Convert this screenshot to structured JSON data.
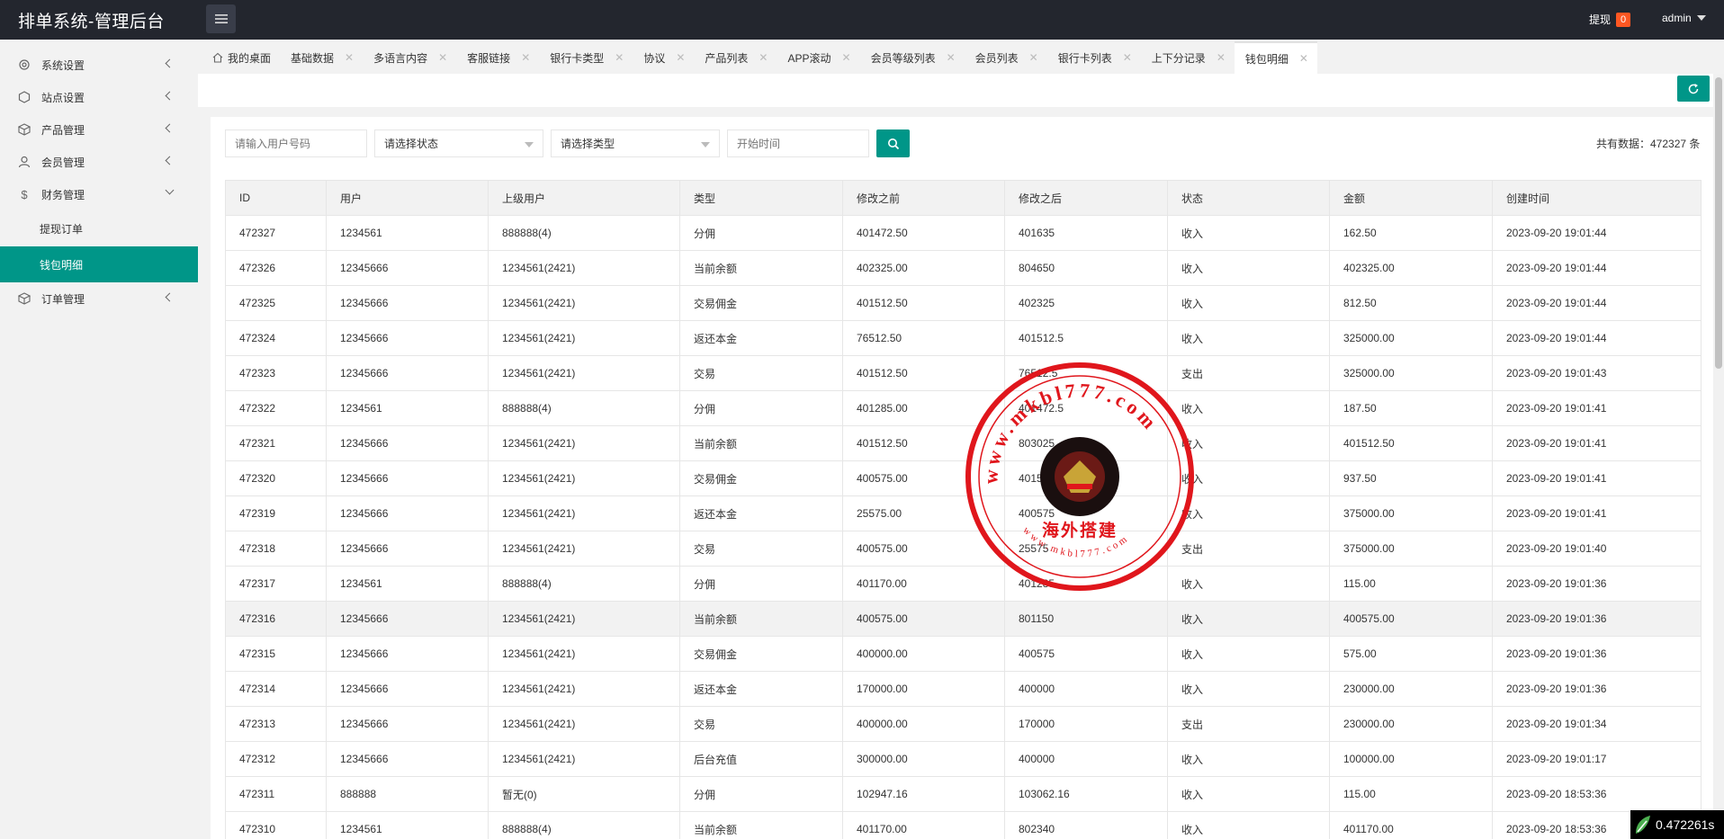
{
  "app": {
    "title": "排单系统-管理后台"
  },
  "header": {
    "withdraw_label": "提现",
    "withdraw_badge": "0",
    "user": "admin"
  },
  "sidebar": {
    "items": [
      {
        "label": "系统设置",
        "icon": "gear-icon"
      },
      {
        "label": "站点设置",
        "icon": "settings-icon"
      },
      {
        "label": "产品管理",
        "icon": "cube-icon"
      },
      {
        "label": "会员管理",
        "icon": "user-icon"
      },
      {
        "label": "财务管理",
        "icon": "dollar-icon"
      },
      {
        "label": "订单管理",
        "icon": "cube-icon"
      }
    ],
    "sub_items": [
      {
        "label": "提现订单"
      },
      {
        "label": "钱包明细"
      }
    ]
  },
  "tabs": [
    {
      "label": "我的桌面"
    },
    {
      "label": "基础数据"
    },
    {
      "label": "多语言内容"
    },
    {
      "label": "客服链接"
    },
    {
      "label": "银行卡类型"
    },
    {
      "label": "协议"
    },
    {
      "label": "产品列表"
    },
    {
      "label": "APP滚动"
    },
    {
      "label": "会员等级列表"
    },
    {
      "label": "会员列表"
    },
    {
      "label": "银行卡列表"
    },
    {
      "label": "上下分记录"
    },
    {
      "label": "钱包明细"
    }
  ],
  "filters": {
    "user_placeholder": "请输入用户号码",
    "status_select": "请选择状态",
    "type_select": "请选择类型",
    "time_placeholder": "开始时间"
  },
  "summary": {
    "total_text": "共有数据：472327 条"
  },
  "table": {
    "headers": [
      "ID",
      "用户",
      "上级用户",
      "类型",
      "修改之前",
      "修改之后",
      "状态",
      "金额",
      "创建时间"
    ],
    "rows": [
      [
        "472327",
        "1234561",
        "888888(4)",
        "分佣",
        "401472.50",
        "401635",
        "收入",
        "162.50",
        "2023-09-20 19:01:44"
      ],
      [
        "472326",
        "12345666",
        "1234561(2421)",
        "当前余额",
        "402325.00",
        "804650",
        "收入",
        "402325.00",
        "2023-09-20 19:01:44"
      ],
      [
        "472325",
        "12345666",
        "1234561(2421)",
        "交易佣金",
        "401512.50",
        "402325",
        "收入",
        "812.50",
        "2023-09-20 19:01:44"
      ],
      [
        "472324",
        "12345666",
        "1234561(2421)",
        "返还本金",
        "76512.50",
        "401512.5",
        "收入",
        "325000.00",
        "2023-09-20 19:01:44"
      ],
      [
        "472323",
        "12345666",
        "1234561(2421)",
        "交易",
        "401512.50",
        "76512.5",
        "支出",
        "325000.00",
        "2023-09-20 19:01:43"
      ],
      [
        "472322",
        "1234561",
        "888888(4)",
        "分佣",
        "401285.00",
        "401472.5",
        "收入",
        "187.50",
        "2023-09-20 19:01:41"
      ],
      [
        "472321",
        "12345666",
        "1234561(2421)",
        "当前余额",
        "401512.50",
        "803025",
        "收入",
        "401512.50",
        "2023-09-20 19:01:41"
      ],
      [
        "472320",
        "12345666",
        "1234561(2421)",
        "交易佣金",
        "400575.00",
        "401512.5",
        "收入",
        "937.50",
        "2023-09-20 19:01:41"
      ],
      [
        "472319",
        "12345666",
        "1234561(2421)",
        "返还本金",
        "25575.00",
        "400575",
        "收入",
        "375000.00",
        "2023-09-20 19:01:41"
      ],
      [
        "472318",
        "12345666",
        "1234561(2421)",
        "交易",
        "400575.00",
        "25575",
        "支出",
        "375000.00",
        "2023-09-20 19:01:40"
      ],
      [
        "472317",
        "1234561",
        "888888(4)",
        "分佣",
        "401170.00",
        "401285",
        "收入",
        "115.00",
        "2023-09-20 19:01:36"
      ],
      [
        "472316",
        "12345666",
        "1234561(2421)",
        "当前余额",
        "400575.00",
        "801150",
        "收入",
        "400575.00",
        "2023-09-20 19:01:36"
      ],
      [
        "472315",
        "12345666",
        "1234561(2421)",
        "交易佣金",
        "400000.00",
        "400575",
        "收入",
        "575.00",
        "2023-09-20 19:01:36"
      ],
      [
        "472314",
        "12345666",
        "1234561(2421)",
        "返还本金",
        "170000.00",
        "400000",
        "收入",
        "230000.00",
        "2023-09-20 19:01:36"
      ],
      [
        "472313",
        "12345666",
        "1234561(2421)",
        "交易",
        "400000.00",
        "170000",
        "支出",
        "230000.00",
        "2023-09-20 19:01:34"
      ],
      [
        "472312",
        "12345666",
        "1234561(2421)",
        "后台充值",
        "300000.00",
        "400000",
        "收入",
        "100000.00",
        "2023-09-20 19:01:17"
      ],
      [
        "472311",
        "888888",
        "暂无(0)",
        "分佣",
        "102947.16",
        "103062.16",
        "收入",
        "115.00",
        "2023-09-20 18:53:36"
      ],
      [
        "472310",
        "1234561",
        "888888(4)",
        "当前余额",
        "401170.00",
        "802340",
        "收入",
        "401170.00",
        "2023-09-20 18:53:36"
      ]
    ]
  },
  "watermark": {
    "url_text": "www.mkbl777.com",
    "caption": "海外搭建"
  },
  "timer": {
    "text": "0.472261s"
  },
  "colors": {
    "accent": "#009688",
    "topbar": "#23262e",
    "badge": "#ff5722",
    "stamp": "#e0161c"
  }
}
